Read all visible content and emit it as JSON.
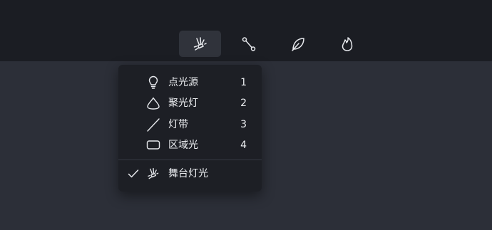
{
  "toolbar": {
    "tools": [
      {
        "icon": "stage-light-icon",
        "active": true
      },
      {
        "icon": "path-icon",
        "active": false
      },
      {
        "icon": "leaf-icon",
        "active": false
      },
      {
        "icon": "flame-icon",
        "active": false
      }
    ]
  },
  "menu": {
    "items": [
      {
        "icon": "bulb-icon",
        "label": "点光源",
        "shortcut": "1"
      },
      {
        "icon": "spotlight-icon",
        "label": "聚光灯",
        "shortcut": "2"
      },
      {
        "icon": "line-icon",
        "label": "灯带",
        "shortcut": "3"
      },
      {
        "icon": "rectangle-icon",
        "label": "区域光",
        "shortcut": "4"
      }
    ],
    "checked_item": {
      "icon": "stage-light-icon",
      "label": "舞台灯光",
      "checked": true
    }
  },
  "colors": {
    "toolbar_bg": "#1b1d23",
    "canvas_bg": "#2c2f38",
    "menu_bg": "#1d1f25",
    "active_tool_bg": "#30333b",
    "text": "#eceef1"
  }
}
